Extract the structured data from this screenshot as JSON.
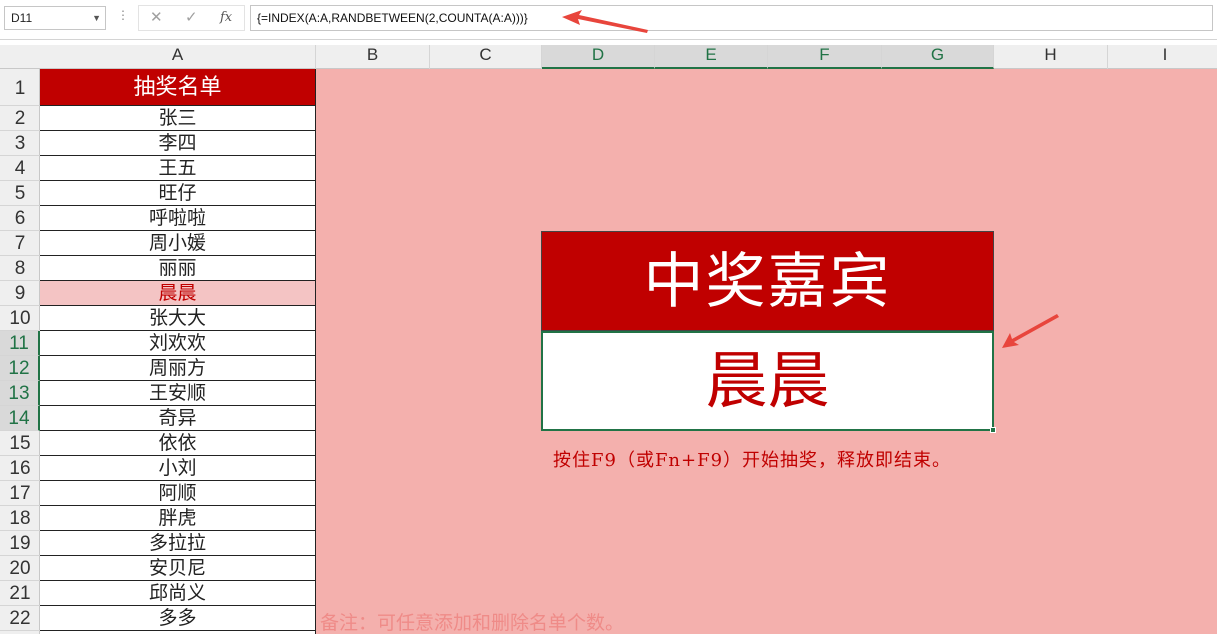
{
  "formula_bar": {
    "name_box": "D11",
    "cancel_glyph": "✕",
    "enter_glyph": "✓",
    "fx_label": "fx",
    "formula": "{=INDEX(A:A,RANDBETWEEN(2,COUNTA(A:A)))}"
  },
  "columns": [
    "A",
    "B",
    "C",
    "D",
    "E",
    "F",
    "G",
    "H",
    "I"
  ],
  "selected_columns": [
    "D",
    "E",
    "F",
    "G"
  ],
  "rows": [
    "1",
    "2",
    "3",
    "4",
    "5",
    "6",
    "7",
    "8",
    "9",
    "10",
    "11",
    "12",
    "13",
    "14",
    "15",
    "16",
    "17",
    "18",
    "19",
    "20",
    "21",
    "22"
  ],
  "selected_rows": [
    "11",
    "12",
    "13",
    "14"
  ],
  "sheet": {
    "a1_header": "抽奖名单",
    "names": [
      "张三",
      "李四",
      "王五",
      "旺仔",
      "呼啦啦",
      "周小媛",
      "丽丽",
      "晨晨",
      "张大大",
      "刘欢欢",
      "周丽方",
      "王安顺",
      "奇异",
      "依依",
      "小刘",
      "阿顺",
      "胖虎",
      "多拉拉",
      "安贝尼",
      "邱尚义",
      "多多"
    ],
    "highlighted_name": "晨晨"
  },
  "prize": {
    "title": "中奖嘉宾",
    "winner": "晨晨"
  },
  "hint": "按住F9（或Fn+F9）开始抽奖，释放即结束。",
  "note": "备注：可任意添加和删除名单个数。",
  "colors": {
    "header_red": "#c00000",
    "pink_background": "#f4b0ad",
    "highlight_row": "#f4c4c4",
    "selection_green": "#217346",
    "arrow_red": "#e8453c"
  },
  "icons": {
    "cancel": "cancel-icon",
    "enter": "check-icon",
    "function": "fx-icon",
    "annotation_arrow": "red-arrow-icon"
  }
}
